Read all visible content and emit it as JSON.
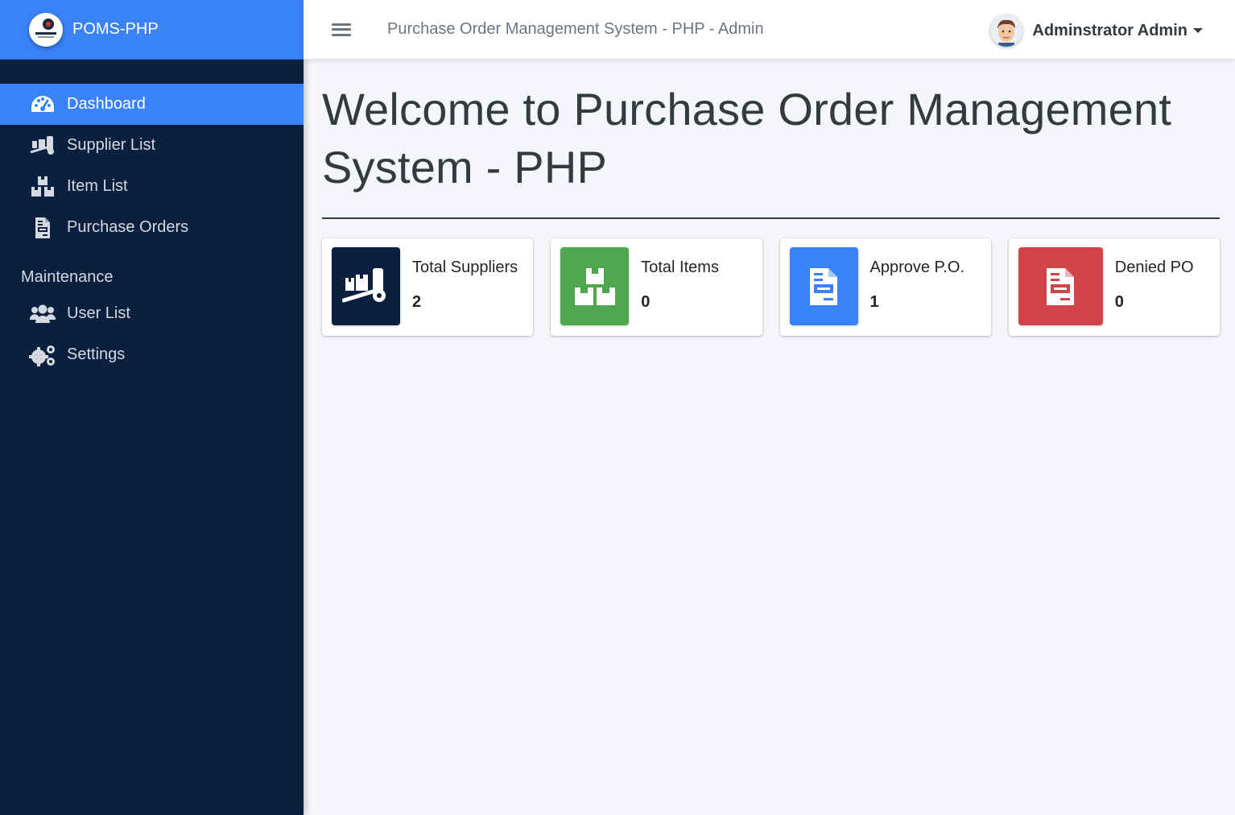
{
  "brand": {
    "name": "POMS-PHP"
  },
  "sidebar": {
    "items": [
      {
        "label": "Dashboard",
        "icon": "tachometer-icon"
      },
      {
        "label": "Supplier List",
        "icon": "truck-loading-icon"
      },
      {
        "label": "Item List",
        "icon": "boxes-icon"
      },
      {
        "label": "Purchase Orders",
        "icon": "file-invoice-icon"
      }
    ],
    "maintenance_header": "Maintenance",
    "maintenance_items": [
      {
        "label": "User List",
        "icon": "users-icon"
      },
      {
        "label": "Settings",
        "icon": "cogs-icon"
      }
    ]
  },
  "topbar": {
    "title": "Purchase Order Management System - PHP - Admin",
    "user_name": "Adminstrator Admin"
  },
  "main": {
    "heading": "Welcome to Purchase Order Management System - PHP",
    "cards": [
      {
        "label": "Total Suppliers",
        "value": "2",
        "color": "#0b1f3f",
        "icon": "truck-loading-icon"
      },
      {
        "label": "Total Items",
        "value": "0",
        "color": "#4ea74e",
        "icon": "boxes-icon"
      },
      {
        "label": "Approve P.O.",
        "value": "1",
        "color": "#3a82f7",
        "icon": "file-invoice-icon"
      },
      {
        "label": "Denied PO",
        "value": "0",
        "color": "#cf4349",
        "icon": "file-invoice-icon"
      }
    ]
  },
  "colors": {
    "accent": "#3a82f7",
    "sidebar_bg": "#0b1f3f",
    "page_bg": "#f4f6f9"
  }
}
